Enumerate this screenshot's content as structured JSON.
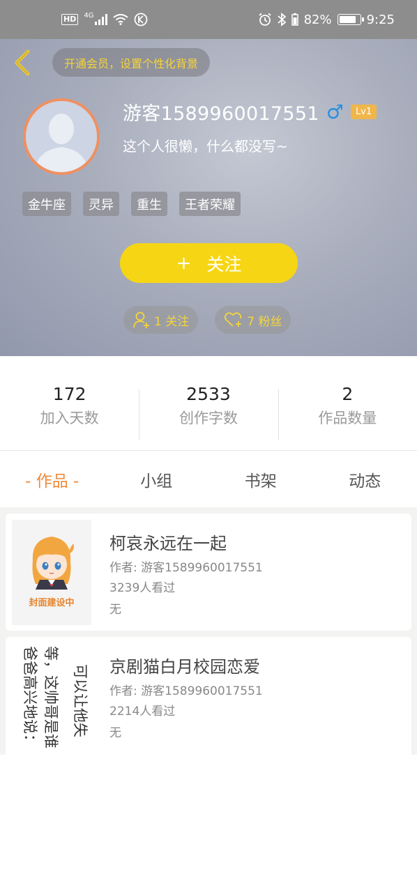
{
  "status_bar": {
    "left_hd": "HD",
    "left_network": "4G",
    "battery_percent_label": "82%",
    "battery_level": 0.82,
    "time": "9:25"
  },
  "header": {
    "vip_banner": "开通会员，设置个性化背景",
    "username": "游客1589960017551",
    "gender_symbol": "♂",
    "level": "Lv1",
    "bio": "这个人很懒，什么都没写~",
    "tags": [
      "金牛座",
      "灵异",
      "重生",
      "王者荣耀"
    ],
    "follow_plus": "+",
    "follow_label": "关注",
    "following_label": "1 关注",
    "fans_label": "7 粉丝",
    "colors": {
      "accent_yellow": "#f6d614",
      "level_badge": "#f0b64a",
      "gender_blue": "#2a8fe0",
      "avatar_border": "#f09060"
    }
  },
  "stats": [
    {
      "value": "172",
      "label": "加入天数"
    },
    {
      "value": "2533",
      "label": "创作字数"
    },
    {
      "value": "2",
      "label": "作品数量"
    }
  ],
  "tabs": [
    {
      "label": "- 作品 -",
      "active": true
    },
    {
      "label": "小组",
      "active": false
    },
    {
      "label": "书架",
      "active": false
    },
    {
      "label": "动态",
      "active": false
    }
  ],
  "works": [
    {
      "title": "柯哀永远在一起",
      "author": "作者: 游客1589960017551",
      "views": "3239人看过",
      "description": "无",
      "cover_caption": "封面建设中"
    },
    {
      "title": "京剧猫白月校园恋爱",
      "author": "作者: 游客1589960017551",
      "views": "2214人看过",
      "description": "无",
      "cover_lines": [
        "等，这帅哥是谁",
        "爸爸高兴地说：",
        "可以让他失"
      ]
    }
  ]
}
